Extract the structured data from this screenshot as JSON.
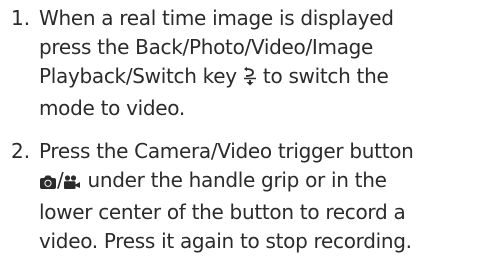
{
  "steps": [
    {
      "number": "1.",
      "lines": [
        "When a real time image is displayed",
        "press the Back/Photo/Video/Image",
        "Playback/Switch key",
        "to switch the",
        "mode to video."
      ],
      "icon": "switch-key-icon"
    },
    {
      "number": "2.",
      "lines": [
        "Press the Camera/Video trigger button",
        "/",
        "under the handle grip or in the",
        "lower center of the button to record a",
        "video. Press it again to stop recording."
      ],
      "icons": [
        "camera-icon",
        "video-camera-icon"
      ]
    }
  ]
}
